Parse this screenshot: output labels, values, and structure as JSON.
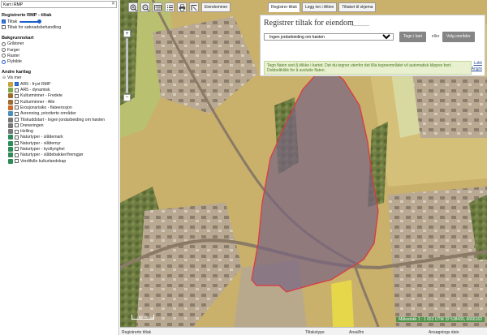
{
  "sidebar": {
    "search_value": "Kart i RMP",
    "sections": [
      {
        "title": "Registrerte RMP - tiltak",
        "rows": [
          {
            "type": "check",
            "checked": true,
            "label": "Tiltak",
            "slider": true
          },
          {
            "type": "check",
            "checked": false,
            "label": "Tiltak for søknadsbehandling"
          }
        ]
      },
      {
        "title": "Bakgrunnskart",
        "rows": [
          {
            "type": "radio",
            "checked": false,
            "label": "Gråtoner"
          },
          {
            "type": "radio",
            "checked": false,
            "label": "Farger"
          },
          {
            "type": "radio",
            "checked": false,
            "label": "Raster"
          },
          {
            "type": "radio",
            "checked": true,
            "label": "Flybilde"
          }
        ]
      },
      {
        "title": "Andre kartlag",
        "rows": [
          {
            "type": "tree",
            "label": "Vis mer"
          },
          {
            "type": "layer",
            "checked": true,
            "label": "AR5 - fryst RMP",
            "color": "#c9a23a"
          },
          {
            "type": "layer",
            "checked": false,
            "label": "AR5 - dynamisk",
            "color": "#7fa84a"
          },
          {
            "type": "layer",
            "checked": false,
            "label": "Kulturminner - Fredete",
            "color": "#a06b2e"
          },
          {
            "type": "layer",
            "checked": false,
            "label": "Kulturminner - Alle",
            "color": "#a06b2e"
          },
          {
            "type": "layer",
            "checked": false,
            "label": "Erosjonsrisiko - flateerosjon",
            "color": "#cc6b2e"
          },
          {
            "type": "layer",
            "checked": false,
            "label": "Avrenning, prioriterte områder",
            "color": "#4b8fbf"
          },
          {
            "type": "layer",
            "checked": false,
            "label": "Tilskuddstart - Ingen jordarbeiding om høsten",
            "color": "#777777"
          },
          {
            "type": "layer",
            "checked": false,
            "label": "Dreneringen",
            "color": "#777777"
          },
          {
            "type": "layer",
            "checked": false,
            "label": "Helling",
            "color": "#777777"
          },
          {
            "type": "layer",
            "checked": false,
            "label": "Naturtyper - slåttemark",
            "color": "#2e8b57"
          },
          {
            "type": "layer",
            "checked": false,
            "label": "Naturtyper - slåttemyr",
            "color": "#2e8b57"
          },
          {
            "type": "layer",
            "checked": false,
            "label": "Naturtyper - kystlynghei",
            "color": "#2e8b57"
          },
          {
            "type": "layer",
            "checked": false,
            "label": "Naturtyper - slåttebakker/fremgjør",
            "color": "#2e8b57"
          },
          {
            "type": "layer",
            "checked": false,
            "label": "Verdifulle kulturlandskap",
            "color": "#2e8b57"
          }
        ]
      }
    ]
  },
  "toolbar": {
    "icons": [
      "zoom-in-icon",
      "zoom-out-icon",
      "table-icon",
      "list-icon",
      "print-icon",
      "measure-icon"
    ],
    "eiendommer_label": "Eiendommer"
  },
  "tabs": [
    {
      "label": "Registrer tiltak",
      "active": true
    },
    {
      "label": "Legg inn i Altinn",
      "active": false
    },
    {
      "label": "Tiltaket til skjema",
      "active": false
    }
  ],
  "panel": {
    "title": "Registrer tiltak for eiendom",
    "select_value": "Ingen jordarbeiding om høsten",
    "draw_button": "Tegn i kart",
    "or_label": "eller",
    "choose_button": "Velg områder",
    "info": "Tegn flaten ved å klikke i kartet. Det du tegner utenfor det lilla tegneområdet vil automatisk klippes bort. Dobbeltklikk for å avslutte flaten.",
    "links": [
      "Lukk",
      "Angre"
    ]
  },
  "map": {
    "scale_label": "50 m",
    "coords": "Målestokk 1 : 1 652  UTM 32  538430, 6666162"
  },
  "bottom": {
    "col1": "Registrerte tiltak",
    "col2": "Tiltakstype",
    "col3": "Areal/lm",
    "col4": "Ansøgnings dato"
  },
  "colors": {
    "selection": "#e0353f",
    "accent": "#1f5ec9",
    "button_gray": "#858585"
  }
}
